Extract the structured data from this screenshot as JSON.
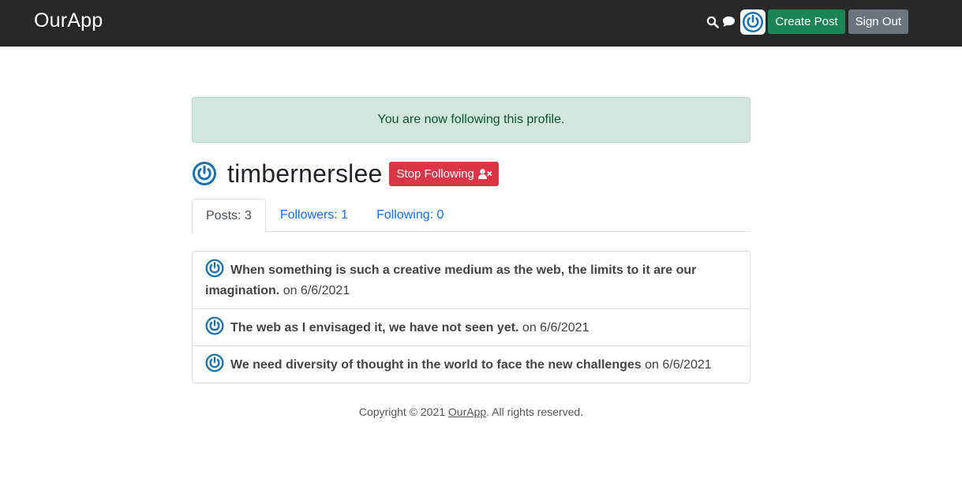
{
  "header": {
    "brand": "OurApp",
    "create_post": "Create Post",
    "sign_out": "Sign Out",
    "icons": [
      "search-icon",
      "chat-icon",
      "avatar-icon"
    ]
  },
  "alert": {
    "message": "You are now following this profile."
  },
  "profile": {
    "username": "timbernerslee",
    "unfollow_label": "Stop Following"
  },
  "tabs": [
    {
      "label": "Posts: 3",
      "active": true
    },
    {
      "label": "Followers: 1",
      "active": false
    },
    {
      "label": "Following: 0",
      "active": false
    }
  ],
  "posts": [
    {
      "title": "When something is such a creative medium as the web, the limits to it are our imagination.",
      "date": "on 6/6/2021"
    },
    {
      "title": "The web as I envisaged it, we have not seen yet.",
      "date": "on 6/6/2021"
    },
    {
      "title": "We need diversity of thought in the world to face the new challenges",
      "date": "on 6/6/2021"
    }
  ],
  "footer": {
    "prefix": "Copyright © 2021 ",
    "link": "OurApp",
    "suffix": ". All rights reserved."
  },
  "colors": {
    "navbar": "#282828",
    "create": "#198754",
    "signout": "#6c757d",
    "unfollow": "#dc3545",
    "alert_bg": "#d1e7dd",
    "link": "#0d6efd",
    "avatar_blue": "#1572b6"
  }
}
